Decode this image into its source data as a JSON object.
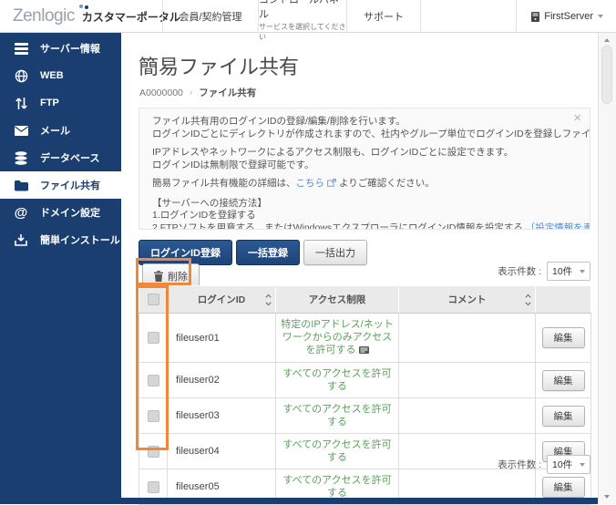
{
  "header": {
    "logo_en": "Zenlogic",
    "logo_jp": "カスタマーポータル",
    "nav": [
      {
        "label": "会員/契約管理",
        "sub": ""
      },
      {
        "label": "コントロールパネル",
        "sub": "サービスを選択してください"
      },
      {
        "label": "サポート",
        "sub": ""
      }
    ],
    "account": "FirstServer"
  },
  "sidebar": {
    "items": [
      {
        "label": "サーバー情報",
        "icon": "server-icon",
        "active": false
      },
      {
        "label": "WEB",
        "icon": "globe-icon",
        "active": false
      },
      {
        "label": "FTP",
        "icon": "up-down-arrows-icon",
        "active": false
      },
      {
        "label": "メール",
        "icon": "mail-icon",
        "active": false
      },
      {
        "label": "データベース",
        "icon": "database-icon",
        "active": false
      },
      {
        "label": "ファイル共有",
        "icon": "folder-icon",
        "active": true
      },
      {
        "label": "ドメイン設定",
        "icon": "at-icon",
        "active": false
      },
      {
        "label": "簡単インストール",
        "icon": "install-icon",
        "active": false
      }
    ]
  },
  "main": {
    "title": "簡易ファイル共有",
    "breadcrumb": {
      "root": "A0000000",
      "separator": "›",
      "current": "ファイル共有"
    },
    "info": {
      "close": "×",
      "p1_line1": "ファイル共有用のログインIDの登録/編集/削除を行います。",
      "p1_line2": "ログインIDごとにディレクトリが作成されますので、社内やグループ単位でログインIDを登録しファイルの共有が可能です。",
      "p2_line1": "IPアドレスやネットワークによるアクセス制限も、ログインIDごとに設定できます。",
      "p2_line2": "ログインIDは無制限で登録可能です。",
      "p3_pre": "簡易ファイル共有機能の詳細は、",
      "p3_link": "こちら",
      "p3_post": "よりご確認ください。",
      "p4_title": "【サーバーへの接続方法】",
      "p4_step1": "1.ログインIDを登録する",
      "p4_step2": "2.FTPソフトを用意する、またはWindowsエクスプローラにログインID情報を設定する",
      "p4_link": "〔設定情報を表示〕"
    },
    "buttons": {
      "register": "ログインID登録",
      "bulk_register": "一括登録",
      "bulk_export": "一括出力",
      "delete": "削除",
      "edit": "編集"
    },
    "display_count": {
      "label": "表示件数 :",
      "value": "10件"
    },
    "table": {
      "headers": {
        "login_id": "ログインID",
        "access": "アクセス制限",
        "comment": "コメント"
      },
      "rows": [
        {
          "login_id": "fileuser01",
          "access": "特定のIPアドレス/ネットワークからのみアクセスを許可する",
          "icon": "ip-list-icon",
          "comment": ""
        },
        {
          "login_id": "fileuser02",
          "access": "すべてのアクセスを許可する",
          "comment": ""
        },
        {
          "login_id": "fileuser03",
          "access": "すべてのアクセスを許可する",
          "comment": ""
        },
        {
          "login_id": "fileuser04",
          "access": "すべてのアクセスを許可する",
          "comment": ""
        },
        {
          "login_id": "fileuser05",
          "access": "すべてのアクセスを許可する",
          "comment": ""
        }
      ]
    }
  },
  "colors": {
    "sidebar_navy": "#1b3e70",
    "button_navy": "#21497e",
    "link_blue": "#4c8bd4",
    "status_green": "#5ba05b",
    "annotation_orange": "#f0883b"
  }
}
